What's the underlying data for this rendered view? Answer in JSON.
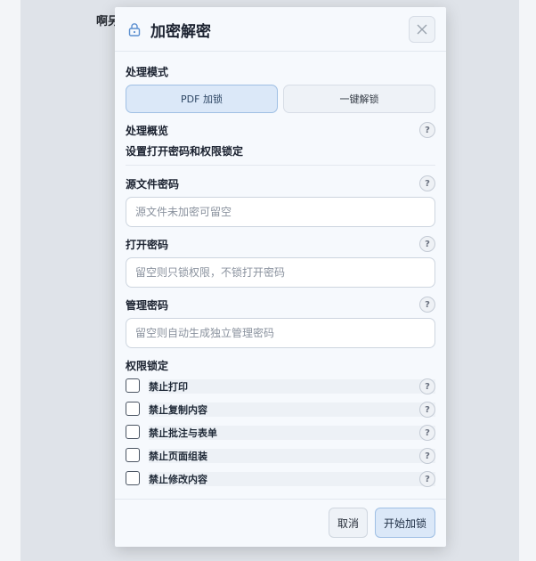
{
  "background": {
    "text": "啊另"
  },
  "dialog": {
    "title": "加密解密",
    "mode": {
      "label": "处理模式",
      "options": [
        "PDF 加锁",
        "一键解锁"
      ],
      "selected": "PDF 加锁"
    },
    "summary": {
      "label": "处理概览",
      "text": "设置打开密码和权限锁定"
    },
    "fields": {
      "source_password": {
        "label": "源文件密码",
        "placeholder": "源文件未加密可留空",
        "value": ""
      },
      "open_password": {
        "label": "打开密码",
        "placeholder": "留空则只锁权限，不锁打开密码",
        "value": ""
      },
      "owner_password": {
        "label": "管理密码",
        "placeholder": "留空则自动生成独立管理密码",
        "value": ""
      }
    },
    "permissions": {
      "label": "权限锁定",
      "items": [
        {
          "label": "禁止打印",
          "checked": false
        },
        {
          "label": "禁止复制内容",
          "checked": false
        },
        {
          "label": "禁止批注与表单",
          "checked": false
        },
        {
          "label": "禁止页面组装",
          "checked": false
        },
        {
          "label": "禁止修改内容",
          "checked": false
        }
      ]
    },
    "help_glyph": "?",
    "buttons": {
      "cancel": "取消",
      "start": "开始加锁"
    },
    "colors": {
      "accent": "#9fbfe4",
      "accent_bg": "#dbe8f8",
      "icon": "#5b8fd0"
    }
  }
}
